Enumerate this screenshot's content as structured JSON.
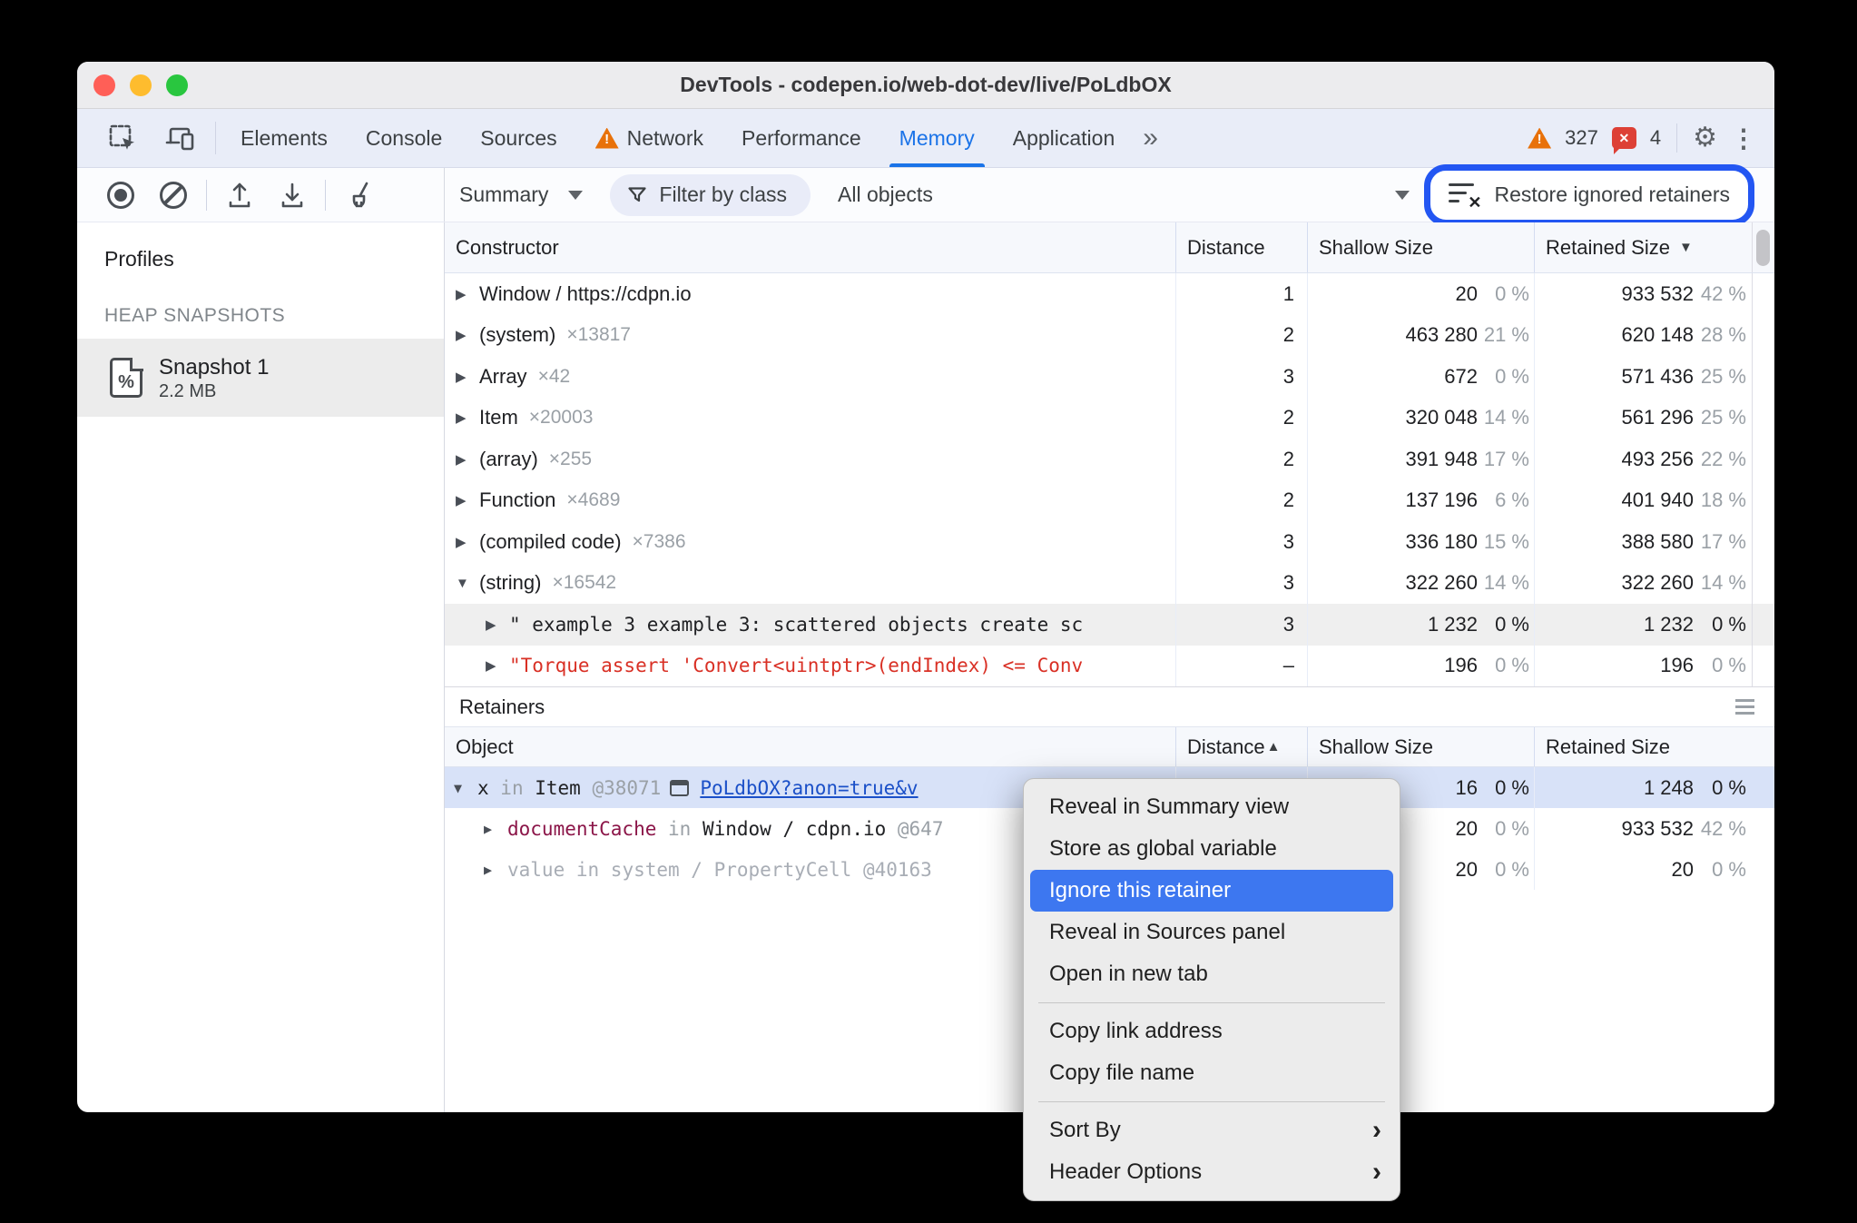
{
  "window_title": "DevTools - codepen.io/web-dot-dev/live/PoLdbOX",
  "tabbar": {
    "tabs": [
      "Elements",
      "Console",
      "Sources",
      "Network",
      "Performance",
      "Memory",
      "Application"
    ],
    "more_tabs_icon": "»",
    "warning_icon_glyph": "!",
    "warning_count": "327",
    "error_icon_glyph": "✕",
    "error_count": "4",
    "settings_icon_glyph": "⚙",
    "overflow_icon_glyph": "⋮"
  },
  "toolbar": {
    "profile_view": "Summary",
    "filter_by_class": "Filter by class",
    "objects_filter": "All objects",
    "restore_ignored_retainers": "Restore ignored retainers"
  },
  "sidebar": {
    "heading": "Profiles",
    "section": "HEAP SNAPSHOTS",
    "snapshot_name": "Snapshot 1",
    "snapshot_size": "2.2 MB",
    "snapshot_icon_glyph": "%"
  },
  "heap": {
    "col_constructor": "Constructor",
    "col_distance": "Distance",
    "col_shallow": "Shallow Size",
    "col_retained": "Retained Size",
    "rows": [
      {
        "name": "Window / https://cdpn.io",
        "count": "",
        "distance": "1",
        "shallow": "20",
        "shallow_pct": "0 %",
        "retained": "933 532",
        "retained_pct": "42 %"
      },
      {
        "name": "(system)",
        "count": "×13817",
        "distance": "2",
        "shallow": "463 280",
        "shallow_pct": "21 %",
        "retained": "620 148",
        "retained_pct": "28 %"
      },
      {
        "name": "Array",
        "count": "×42",
        "distance": "3",
        "shallow": "672",
        "shallow_pct": "0 %",
        "retained": "571 436",
        "retained_pct": "25 %"
      },
      {
        "name": "Item",
        "count": "×20003",
        "distance": "2",
        "shallow": "320 048",
        "shallow_pct": "14 %",
        "retained": "561 296",
        "retained_pct": "25 %"
      },
      {
        "name": "(array)",
        "count": "×255",
        "distance": "2",
        "shallow": "391 948",
        "shallow_pct": "17 %",
        "retained": "493 256",
        "retained_pct": "22 %"
      },
      {
        "name": "Function",
        "count": "×4689",
        "distance": "2",
        "shallow": "137 196",
        "shallow_pct": "6 %",
        "retained": "401 940",
        "retained_pct": "18 %"
      },
      {
        "name": "(compiled code)",
        "count": "×7386",
        "distance": "3",
        "shallow": "336 180",
        "shallow_pct": "15 %",
        "retained": "388 580",
        "retained_pct": "17 %"
      },
      {
        "name": "(string)",
        "count": "×16542",
        "distance": "3",
        "shallow": "322 260",
        "shallow_pct": "14 %",
        "retained": "322 260",
        "retained_pct": "14 %"
      },
      {
        "name": "\" example 3 example 3: scattered objects create sc",
        "count": "",
        "distance": "3",
        "shallow": "1 232",
        "shallow_pct": "0 %",
        "retained": "1 232",
        "retained_pct": "0 %"
      },
      {
        "name": "\"Torque assert 'Convert<uintptr>(endIndex) <= Conv",
        "count": "",
        "distance": "–",
        "shallow": "196",
        "shallow_pct": "0 %",
        "retained": "196",
        "retained_pct": "0 %"
      }
    ]
  },
  "retainers": {
    "title": "Retainers",
    "col_object": "Object",
    "col_distance": "Distance",
    "col_shallow": "Shallow Size",
    "col_retained": "Retained Size",
    "rows": [
      {
        "prop": "x",
        "kw": " in ",
        "obj": "Item",
        "id": " @38071",
        "link": "PoLdbOX?anon=true&v",
        "shallow": "16",
        "shallow_pct": "0 %",
        "retained": "1 248",
        "retained_pct": "0 %"
      },
      {
        "prop": "documentCache",
        "kw": " in ",
        "obj": "Window / cdpn.io",
        "id": " @647",
        "link": "",
        "shallow": "20",
        "shallow_pct": "0 %",
        "retained": "933 532",
        "retained_pct": "42 %"
      },
      {
        "prop": "value",
        "kw": " in ",
        "obj": "system / PropertyCell",
        "id": " @40163",
        "link": "",
        "shallow": "20",
        "shallow_pct": "0 %",
        "retained": "20",
        "retained_pct": "0 %"
      }
    ]
  },
  "context_menu": {
    "items": [
      "Reveal in Summary view",
      "Store as global variable",
      "Ignore this retainer",
      "Reveal in Sources panel",
      "Open in new tab",
      "Copy link address",
      "Copy file name",
      "Sort By",
      "Header Options"
    ]
  }
}
